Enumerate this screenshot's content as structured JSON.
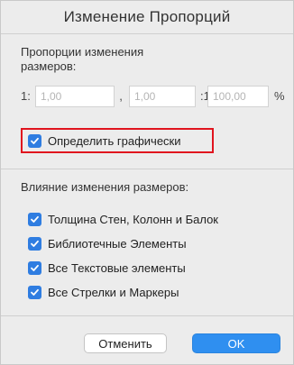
{
  "dialog": {
    "title": "Изменение Пропорций"
  },
  "proportions": {
    "label": "Пропорции изменения размеров:",
    "prefix": "1:",
    "field1_value": "1,00",
    "separator1": ",",
    "field2_value": "1,00",
    "separator2": ":1,",
    "field3_value": "100,00",
    "unit": "%"
  },
  "graphic_option": {
    "label": "Определить графически",
    "checked": true
  },
  "influence": {
    "label": "Влияние изменения размеров:",
    "items": [
      {
        "label": "Толщина Стен, Колонн и Балок",
        "checked": true
      },
      {
        "label": "Библиотечные Элементы",
        "checked": true
      },
      {
        "label": "Все Текстовые элементы",
        "checked": true
      },
      {
        "label": "Все Стрелки и Маркеры",
        "checked": true
      }
    ]
  },
  "buttons": {
    "cancel": "Отменить",
    "ok": "OK"
  },
  "colors": {
    "accent": "#2f7de1",
    "highlight_border": "#e0141e"
  }
}
